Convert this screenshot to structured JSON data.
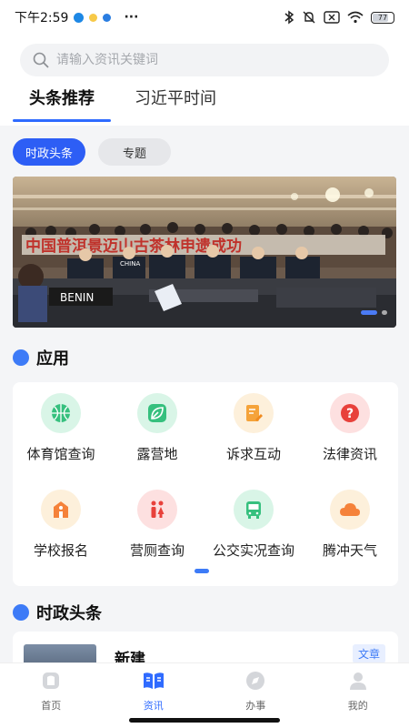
{
  "status_bar": {
    "time": "下午2:59",
    "more": "···",
    "battery": "77"
  },
  "search": {
    "placeholder": "请输入资讯关键词"
  },
  "tabs": [
    {
      "label": "头条推荐",
      "active": true
    },
    {
      "label": "习近平时间",
      "active": false
    }
  ],
  "chips": [
    {
      "label": "时政头条",
      "active": true
    },
    {
      "label": "专题",
      "active": false
    }
  ],
  "banner": {
    "banner_text": "中国普洱景迈山古茶林申遗成功",
    "desk_label": "BENIN",
    "flag_label": "CHINA"
  },
  "apps_section": {
    "title": "应用"
  },
  "apps": [
    {
      "label": "体育馆查询",
      "icon": "basketball-icon",
      "bg": "#d9f5e7",
      "fg": "#36c07e"
    },
    {
      "label": "露营地",
      "icon": "leaf-icon",
      "bg": "#d9f5e7",
      "fg": "#36c07e"
    },
    {
      "label": "诉求互动",
      "icon": "document-edit-icon",
      "bg": "#fdf0db",
      "fg": "#f5a33a"
    },
    {
      "label": "法律资讯",
      "icon": "question-icon",
      "bg": "#fde0e0",
      "fg": "#e8413b"
    },
    {
      "label": "学校报名",
      "icon": "school-icon",
      "bg": "#fdf0db",
      "fg": "#f5823a"
    },
    {
      "label": "营厕查询",
      "icon": "restroom-icon",
      "bg": "#fde0e0",
      "fg": "#e8413b"
    },
    {
      "label": "公交实况查询",
      "icon": "bus-icon",
      "bg": "#d9f5e7",
      "fg": "#36c07e"
    },
    {
      "label": "腾冲天气",
      "icon": "cloud-icon",
      "bg": "#fdf0db",
      "fg": "#f5823a"
    }
  ],
  "news_section": {
    "title": "时政头条"
  },
  "news": {
    "title": "新建",
    "tag": "文章"
  },
  "bottom_nav": [
    {
      "label": "首页",
      "icon": "home-icon",
      "active": false
    },
    {
      "label": "资讯",
      "icon": "news-icon",
      "active": true
    },
    {
      "label": "办事",
      "icon": "compass-icon",
      "active": false
    },
    {
      "label": "我的",
      "icon": "user-icon",
      "active": false
    }
  ],
  "colors": {
    "accent": "#2f6bff",
    "chip_active": "#2d5ef5"
  }
}
